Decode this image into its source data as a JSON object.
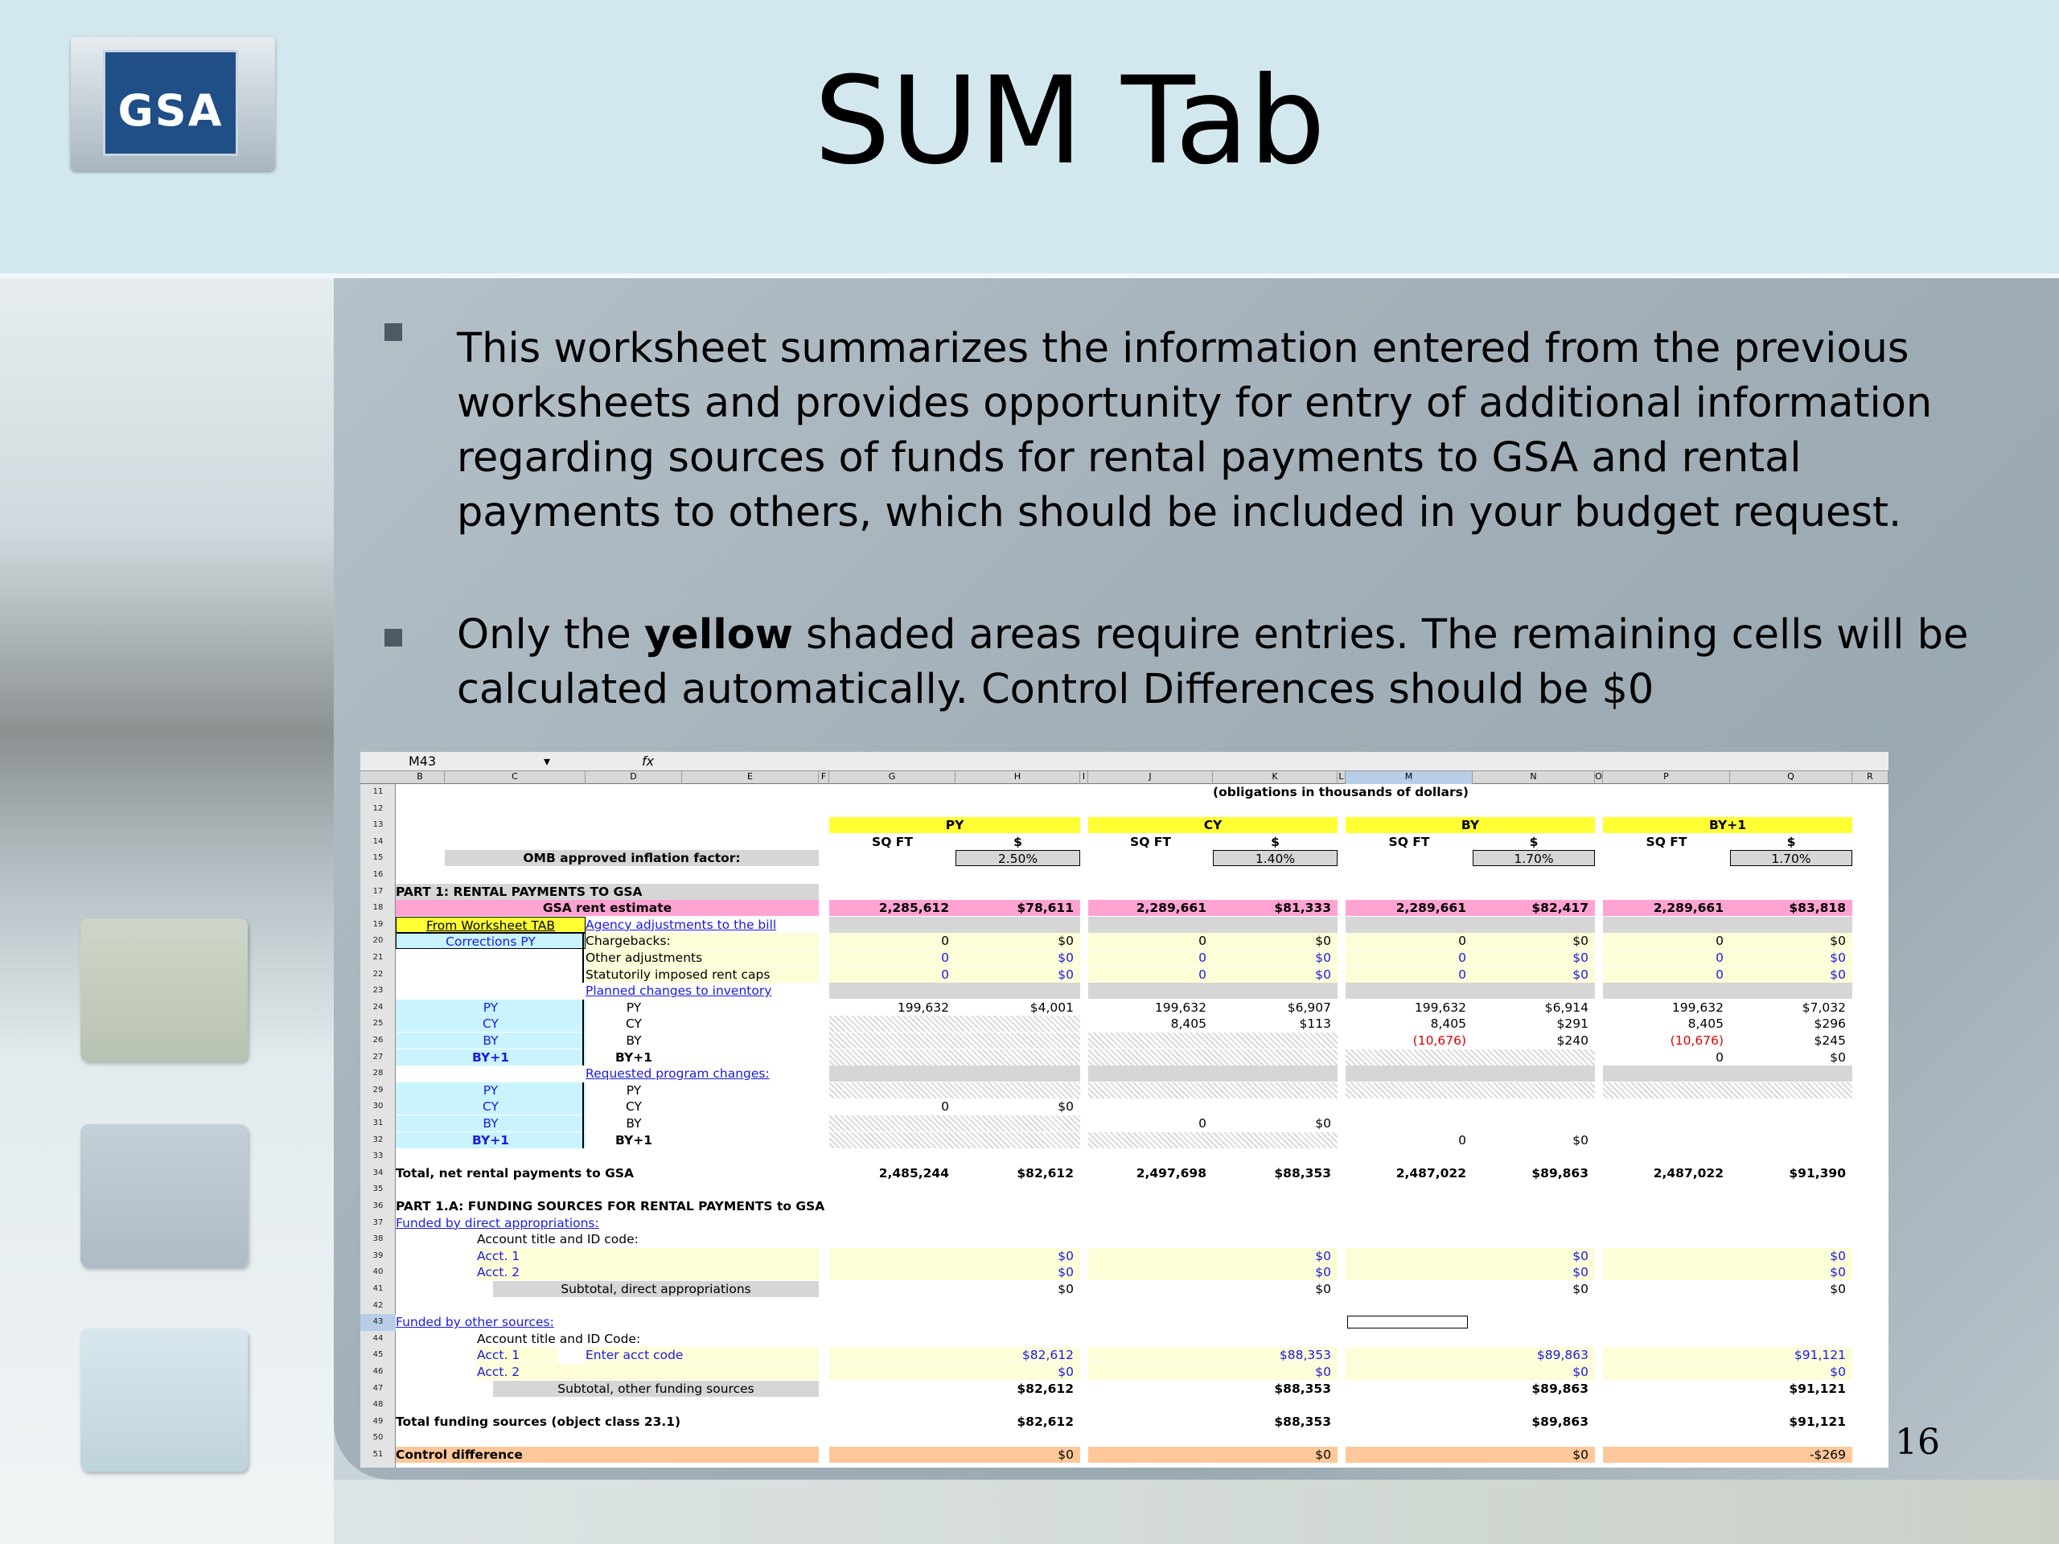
{
  "slide": {
    "title": "SUM Tab",
    "logo_text": "GSA",
    "page_number": "16",
    "bullets": [
      {
        "text": "This worksheet summarizes the information entered from the previous worksheets and provides opportunity for entry of additional information regarding sources of funds for rental payments to GSA and rental payments to others, which should be included in your budget request."
      },
      {
        "pre": "Only the ",
        "bold": "yellow",
        "post": " shaded areas require entries.  The remaining cells will be calculated automatically. Control Differences should be $0"
      }
    ]
  },
  "sheet": {
    "name_box": "M43",
    "fx": "fx",
    "columns": [
      "B",
      "C",
      "D",
      "E",
      "F",
      "G",
      "H",
      "I",
      "J",
      "K",
      "L",
      "M",
      "N",
      "O",
      "P",
      "Q",
      "R"
    ],
    "rows": [
      "11",
      "12",
      "13",
      "14",
      "15",
      "16",
      "17",
      "18",
      "19",
      "20",
      "21",
      "22",
      "23",
      "24",
      "25",
      "26",
      "27",
      "28",
      "29",
      "30",
      "31",
      "32",
      "33",
      "34",
      "35",
      "36",
      "37",
      "38",
      "39",
      "40",
      "41",
      "42",
      "43",
      "44",
      "45",
      "46",
      "47",
      "48",
      "49",
      "50",
      "51"
    ],
    "caption": "(obligations in thousands of dollars)",
    "year_headers": [
      "PY",
      "CY",
      "BY",
      "BY+1"
    ],
    "sqft_label": "SQ FT",
    "dollar_label": "$",
    "inflation_label": "OMB approved inflation factor:",
    "inflation": [
      "2.50%",
      "1.40%",
      "1.70%",
      "1.70%"
    ],
    "part1": "PART 1:  RENTAL PAYMENTS TO GSA",
    "gsa_rent_label": "GSA rent estimate",
    "gsa_rent": [
      [
        "2,285,612",
        "$78,611"
      ],
      [
        "2,289,661",
        "$81,333"
      ],
      [
        "2,289,661",
        "$82,417"
      ],
      [
        "2,289,661",
        "$83,818"
      ]
    ],
    "from_worksheet": "From Worksheet TAB",
    "agency_adj": "Agency adjustments to the bill",
    "corrections": "Corrections PY",
    "chargebacks": "Chargebacks:",
    "other_adj": "Other adjustments",
    "statutory": "Statutorily imposed rent caps",
    "adj_values": [
      "0",
      "$0"
    ],
    "planned": "Planned changes to inventory",
    "program": "Requested program changes:",
    "py": "PY",
    "cy": "CY",
    "by": "BY",
    "by1": "BY+1",
    "inv_py": [
      [
        "199,632",
        "$4,001"
      ],
      [
        "199,632",
        "$6,907"
      ],
      [
        "199,632",
        "$6,914"
      ],
      [
        "199,632",
        "$7,032"
      ]
    ],
    "inv_cy": [
      [
        "8,405",
        "$113"
      ],
      [
        "8,405",
        "$291"
      ],
      [
        "8,405",
        "$296"
      ]
    ],
    "inv_by": [
      [
        "(10,676)",
        "$240"
      ],
      [
        "(10,676)",
        "$245"
      ]
    ],
    "inv_by1": [
      "0",
      "$0"
    ],
    "prog_zero": [
      "0",
      "$0"
    ],
    "total_net_label": "Total, net rental payments to GSA",
    "total_net": [
      [
        "2,485,244",
        "$82,612"
      ],
      [
        "2,497,698",
        "$88,353"
      ],
      [
        "2,487,022",
        "$89,863"
      ],
      [
        "2,487,022",
        "$91,390"
      ]
    ],
    "part1a": "PART 1.A:  FUNDING SOURCES FOR RENTAL PAYMENTS to GSA",
    "direct": "Funded by direct appropriations:",
    "acct_title": "Account title and ID code:",
    "acct_title2": "Account title and ID Code:",
    "acct1": "Acct. 1",
    "acct2": "Acct. 2",
    "subtotal_direct": "Subtotal, direct appropriations",
    "other_sources": "Funded by other sources:",
    "enter_acct": "Enter acct code",
    "zero": "$0",
    "acct1_other": [
      "$82,612",
      "$88,353",
      "$89,863",
      "$91,121"
    ],
    "subtotal_other_label": "Subtotal, other funding sources",
    "subtotal_other": [
      "$82,612",
      "$88,353",
      "$89,863",
      "$91,121"
    ],
    "total_funding_label": "Total funding sources (object class 23.1)",
    "total_funding": [
      "$82,612",
      "$88,353",
      "$89,863",
      "$91,121"
    ],
    "control_label": "Control difference",
    "control": [
      "$0",
      "$0",
      "$0",
      "-$269"
    ]
  }
}
